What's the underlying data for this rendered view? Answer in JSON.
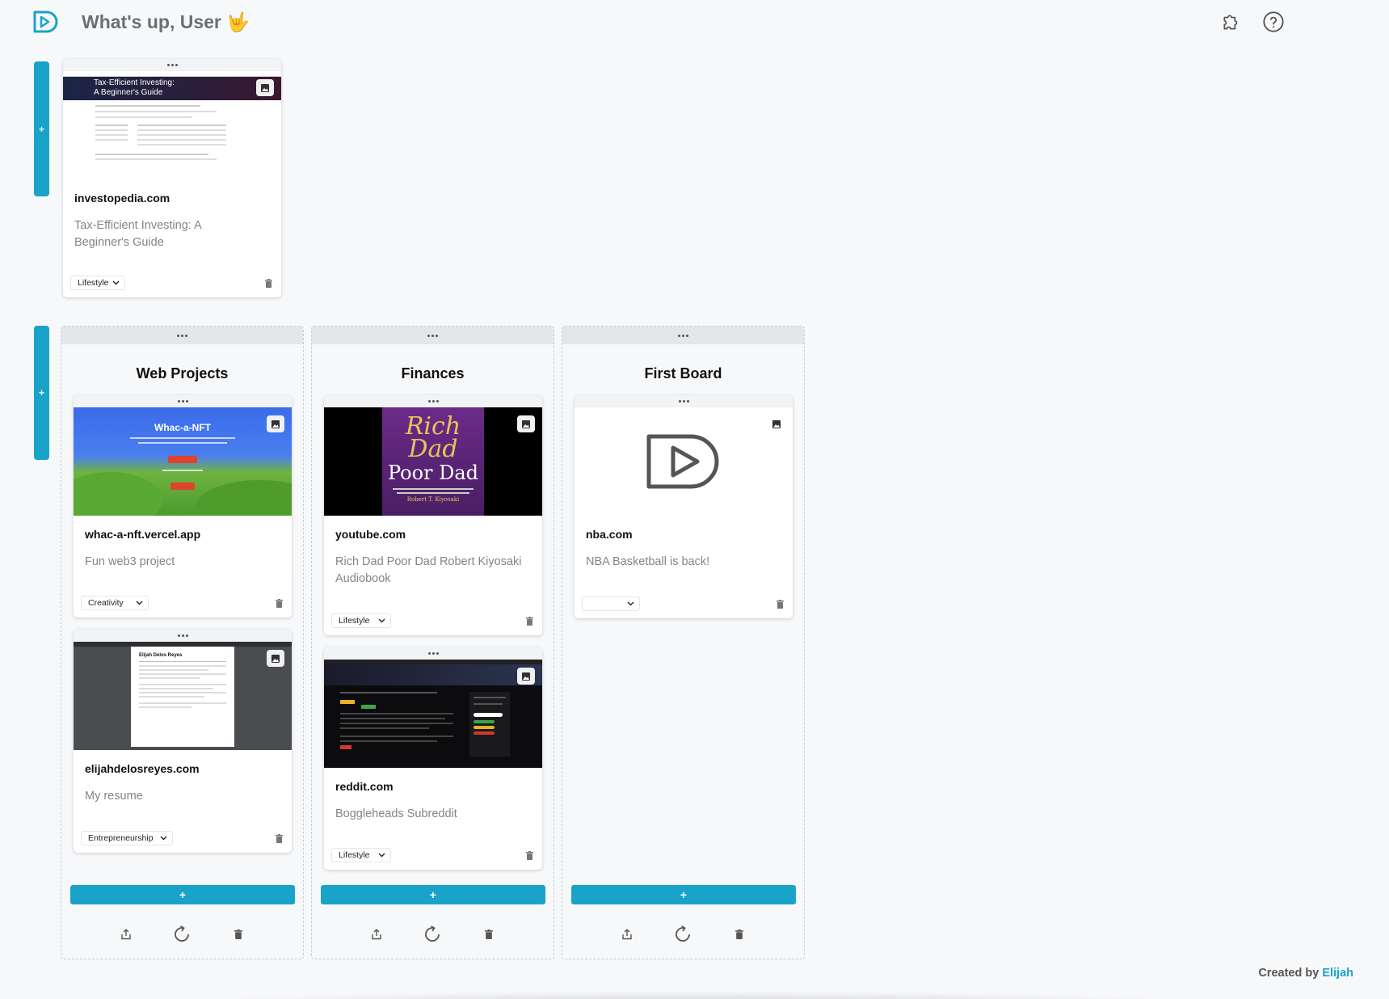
{
  "header": {
    "greeting": "What's up, User",
    "emoji": "🤟"
  },
  "top_row": {
    "add_label": "+",
    "card": {
      "site": "investopedia.com",
      "description": "Tax-Efficient Investing: A Beginner's Guide",
      "category": "Lifestyle",
      "thumb_text_1": "Tax-Efficient Investing:",
      "thumb_text_2": "A Beginner's Guide"
    }
  },
  "boards_row": {
    "add_label": "+"
  },
  "boards": [
    {
      "title": "Web Projects",
      "add_label": "+",
      "cards": [
        {
          "site": "whac-a-nft.vercel.app",
          "description": "Fun web3 project",
          "category": "Creativity",
          "thumb_title": "Whac-a-NFT"
        },
        {
          "site": "elijahdelosreyes.com",
          "description": "My resume",
          "category": "Entrepreneurship",
          "thumb_title": "Elijah Delos Reyes"
        }
      ]
    },
    {
      "title": "Finances",
      "add_label": "+",
      "cards": [
        {
          "site": "youtube.com",
          "description": "Rich Dad Poor Dad Robert Kiyosaki Audiobook",
          "category": "Lifestyle",
          "thumb_line_1": "Rich",
          "thumb_line_2": "Dad",
          "thumb_line_3": "Poor Dad",
          "thumb_author": "Robert T. Kiyosaki"
        },
        {
          "site": "reddit.com",
          "description": "Boggleheads Subreddit",
          "category": "Lifestyle"
        }
      ]
    },
    {
      "title": "First Board",
      "add_label": "+",
      "cards": [
        {
          "site": "nba.com",
          "description": "NBA Basketball is back!",
          "category": ""
        }
      ]
    }
  ],
  "footer": {
    "credit_prefix": "Created by",
    "credit_name": "Elijah"
  },
  "colors": {
    "accent": "#1aa3c9",
    "background": "#f7f8fa"
  }
}
